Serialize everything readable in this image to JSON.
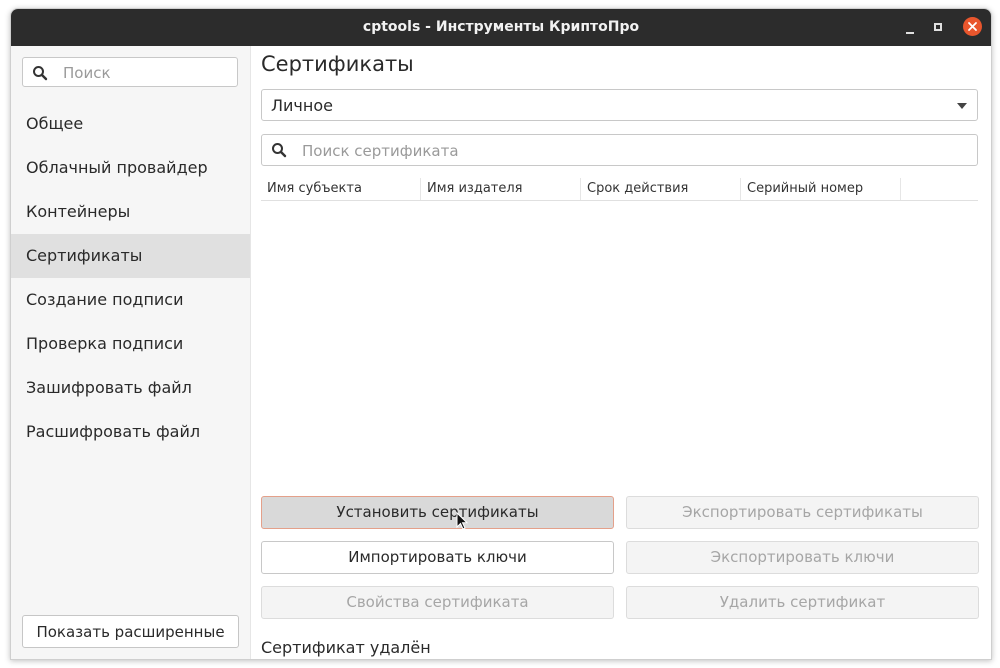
{
  "window": {
    "title": "cptools - Инструменты КриптоПро"
  },
  "sidebar": {
    "search_placeholder": "Поиск",
    "items": [
      {
        "label": "Общее"
      },
      {
        "label": "Облачный провайдер"
      },
      {
        "label": "Контейнеры"
      },
      {
        "label": "Сертификаты"
      },
      {
        "label": "Создание подписи"
      },
      {
        "label": "Проверка подписи"
      },
      {
        "label": "Зашифровать файл"
      },
      {
        "label": "Расшифровать файл"
      }
    ],
    "active_item": "Сертификаты",
    "advanced_button": "Показать расширенные"
  },
  "main": {
    "title": "Сертификаты",
    "store_select": {
      "value": "Личное"
    },
    "search_placeholder": "Поиск сертификата",
    "table": {
      "columns": [
        "Имя субъекта",
        "Имя издателя",
        "Срок действия",
        "Серийный номер"
      ],
      "rows": []
    },
    "buttons": {
      "install": "Установить сертификаты",
      "export_certs": "Экспортировать сертификаты",
      "import_keys": "Импортировать ключи",
      "export_keys": "Экспортировать ключи",
      "properties": "Свойства сертификата",
      "delete": "Удалить сертификат"
    },
    "status": "Сертификат удалён"
  },
  "colors": {
    "titlebar": "#2c2c2c",
    "close_button": "#e9562d",
    "sidebar_bg": "#f6f6f6",
    "active_item_bg": "#e0e0e0",
    "hover_border": "#e4a08a"
  }
}
